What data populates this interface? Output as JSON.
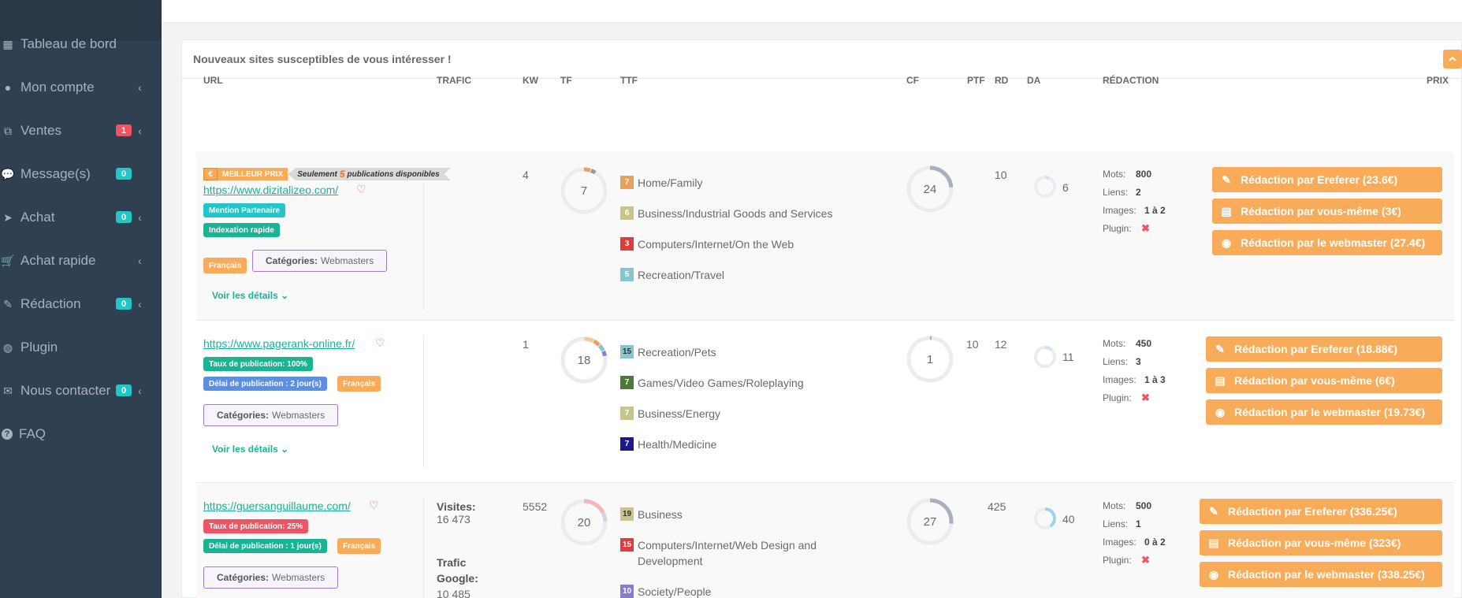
{
  "sidebar": {
    "items": [
      {
        "label": "Tableau de bord",
        "icon": "dashboard-icon",
        "badge": "",
        "chevron": false
      },
      {
        "label": "Mon compte",
        "icon": "user-circle-icon",
        "badge": "",
        "chevron": true
      },
      {
        "label": "Ventes",
        "icon": "clone-icon",
        "badge": "1",
        "badge_color": "#ed5565",
        "chevron": true
      },
      {
        "label": "Message(s)",
        "icon": "chat-icon",
        "badge": "0",
        "badge_color": "#23c6c8",
        "chevron": false
      },
      {
        "label": "Achat",
        "icon": "send-icon",
        "badge": "0",
        "badge_color": "#23c6c8",
        "chevron": true
      },
      {
        "label": "Achat rapide",
        "icon": "cart-icon",
        "badge": "",
        "chevron": true
      },
      {
        "label": "Rédaction",
        "icon": "pencil-icon",
        "badge": "0",
        "badge_color": "#23c6c8",
        "chevron": true
      },
      {
        "label": "Plugin",
        "icon": "globe-icon",
        "badge": "",
        "chevron": false
      },
      {
        "label": "Nous contacter",
        "icon": "envelope-icon",
        "badge": "0",
        "badge_color": "#23c6c8",
        "chevron": true
      },
      {
        "label": "FAQ",
        "icon": "question-icon",
        "badge": "",
        "chevron": false
      }
    ]
  },
  "panel": {
    "title": "Nouveaux sites susceptibles de vous intéresser !",
    "collapse_icon": "chevron-up-icon"
  },
  "table": {
    "headers": {
      "url": "URL",
      "trafic": "TRAFIC",
      "kw": "KW",
      "tf": "TF",
      "ttf": "TTF",
      "cf": "CF",
      "ptf": "PTF",
      "rd": "RD",
      "da": "DA",
      "redaction": "RÉDACTION",
      "prix": "PRIX"
    },
    "rows": [
      {
        "best_price": {
          "euro": "€",
          "label": "MEILLEUR PRIX",
          "prefix": "Seulement",
          "count": "5",
          "suffix": "publications disponibles"
        },
        "url": "https://www.dizitalizeo.com/",
        "labels": [
          "Mention Partenaire",
          "Indexation rapide"
        ],
        "langue": "Français",
        "categories_label": "Catégories:",
        "categories": "Webmasters",
        "details": "Voir les détails",
        "kw": "4",
        "tf": 7,
        "cf": 24,
        "ptf": "",
        "rd": "10",
        "da": 6,
        "ttf": [
          {
            "n": "7",
            "color": "#e8a15c",
            "label": "Home/Family"
          },
          {
            "n": "6",
            "color": "#c9c58a",
            "label": "Business/Industrial Goods and Services"
          },
          {
            "n": "3",
            "color": "#e03c3c",
            "label": "Computers/Internet/On the Web"
          },
          {
            "n": "5",
            "color": "#85c6cf",
            "label": "Recreation/Travel"
          }
        ],
        "meta": {
          "mots_label": "Mots:",
          "mots": "800",
          "liens_label": "Liens:",
          "liens": "2",
          "images_label": "Images:",
          "images": "1 à 2",
          "plugin_label": "Plugin:",
          "plugin": "✖"
        },
        "buttons": [
          "Rédaction par Ereferer (23.6€)",
          "Rédaction par vous-même (3€)",
          "Rédaction par le webmaster (27.4€)"
        ]
      },
      {
        "url": "https://www.pagerank-online.fr/",
        "labels": [
          "Taux de publication: 100%",
          "Délai de publication : 2 jour(s)"
        ],
        "langue": "Français",
        "categories_label": "Catégories:",
        "categories": "Webmasters",
        "details": "Voir les détails",
        "kw": "1",
        "tf": 18,
        "cf": 1,
        "ptf": "10",
        "rd": "12",
        "da": 11,
        "ttf": [
          {
            "n": "15",
            "color": "#85c6cf",
            "label": "Recreation/Pets"
          },
          {
            "n": "7",
            "color": "#4d7a33",
            "label": "Games/Video Games/Roleplaying"
          },
          {
            "n": "7",
            "color": "#c9c58a",
            "label": "Business/Energy"
          },
          {
            "n": "7",
            "color": "#1a1a8c",
            "label": "Health/Medicine"
          }
        ],
        "meta": {
          "mots_label": "Mots:",
          "mots": "450",
          "liens_label": "Liens:",
          "liens": "3",
          "images_label": "Images:",
          "images": "1 à 3",
          "plugin_label": "Plugin:",
          "plugin": "✖"
        },
        "buttons": [
          "Rédaction par Ereferer (18.88€)",
          "Rédaction par vous-même (6€)",
          "Rédaction par le webmaster (19.73€)"
        ]
      },
      {
        "url": "https://guersanguillaume.com/",
        "labels": [
          "Taux de publication: 25%",
          "Délai de publication : 1 jour(s)"
        ],
        "langue": "Français",
        "categories_label": "Catégories:",
        "categories": "Webmasters",
        "visites_label": "Visites:",
        "visites": "16 473",
        "trafic_google_label": "Trafic Google:",
        "trafic_google": "10 485",
        "kw": "5552",
        "tf": 20,
        "cf": 27,
        "ptf": "",
        "rd": "425",
        "da": 40,
        "ttf": [
          {
            "n": "19",
            "color": "#c9c58a",
            "label": "Business"
          },
          {
            "n": "15",
            "color": "#e03c3c",
            "label": "Computers/Internet/Web Design and Development"
          },
          {
            "n": "10",
            "color": "#8a7bd1",
            "label": "Society/People"
          }
        ],
        "meta": {
          "mots_label": "Mots:",
          "mots": "500",
          "liens_label": "Liens:",
          "liens": "1",
          "images_label": "Images:",
          "images": "0 à 2",
          "plugin_label": "Plugin:",
          "plugin": "✖"
        },
        "buttons": [
          "Rédaction par Ereferer (336.25€)",
          "Rédaction par vous-même (323€)",
          "Rédaction par le webmaster (338.25€)"
        ]
      }
    ]
  }
}
